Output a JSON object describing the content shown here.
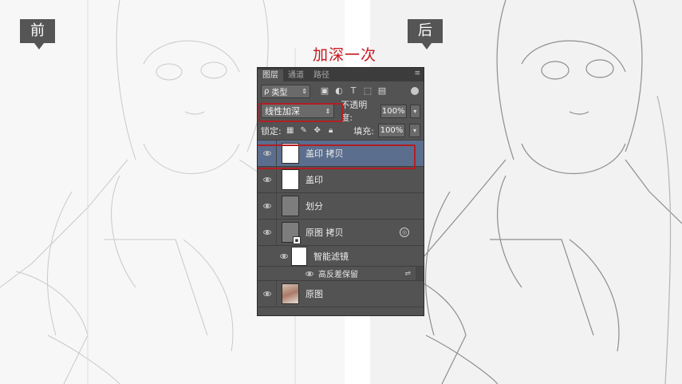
{
  "labels": {
    "before": "前",
    "after": "后",
    "annotation": "加深一次"
  },
  "panel": {
    "tabs": [
      "图层",
      "通道",
      "路径"
    ],
    "active_tab": 0,
    "menu_icon": "panel-menu-icon",
    "filter": {
      "kind_label": "类型",
      "icons": [
        "image-filter-icon",
        "adjustment-filter-icon",
        "type-filter-icon",
        "shape-filter-icon",
        "smart-object-filter-icon"
      ]
    },
    "blend_mode": "线性加深",
    "opacity_label": "不透明度:",
    "opacity_value": "100%",
    "lock_label": "锁定:",
    "lock_icons": [
      "lock-transparent-icon",
      "lock-paint-icon",
      "lock-move-icon",
      "lock-all-icon"
    ],
    "fill_label": "填充:",
    "fill_value": "100%",
    "layers": [
      {
        "name": "盖印 拷贝",
        "thumb": "white",
        "selected": true
      },
      {
        "name": "盖印",
        "thumb": "white",
        "selected": false
      },
      {
        "name": "划分",
        "thumb": "gray",
        "selected": false
      },
      {
        "name": "原图 拷贝",
        "thumb": "gray-smart",
        "selected": false
      }
    ],
    "smart_filters_label": "智能滤镜",
    "smart_filter_item": "高反差保留",
    "bottom_layer": "原图"
  },
  "colors": {
    "annotation_red": "#c8161d",
    "panel_bg": "#535353",
    "selected_layer": "#5b6e8d",
    "highlight_outline": "#b21e24"
  }
}
